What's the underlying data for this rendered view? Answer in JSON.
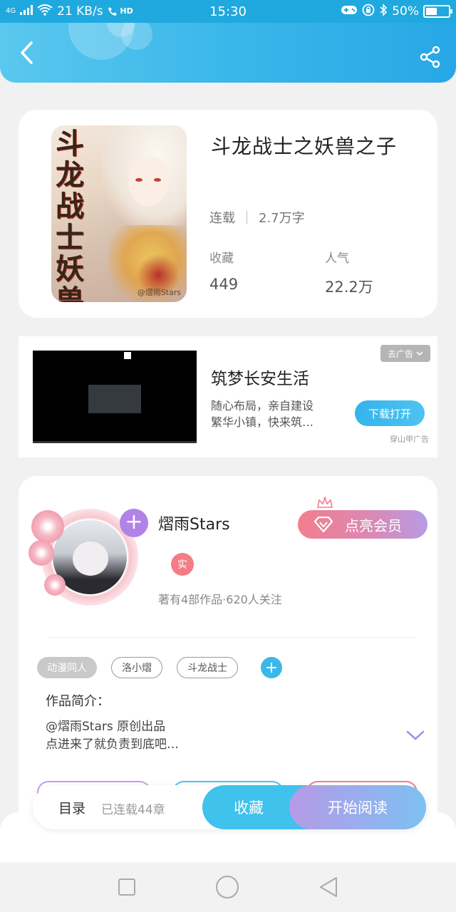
{
  "status_bar": {
    "network": "4G",
    "speed": "21 KB/s",
    "hd": "HD",
    "time": "15:30",
    "battery_percent": "50%",
    "battery_level": 0.5
  },
  "header": {
    "back_icon": "back-arrow-icon",
    "share_icon": "share-icon"
  },
  "book": {
    "title": "斗龙战士之妖兽之子",
    "cover_title": "斗龙战士妖兽之子",
    "cover_watermark": "@熠雨Stars",
    "status": "连载",
    "word_count": "2.7万字",
    "favorites_label": "收藏",
    "favorites_value": "449",
    "popularity_label": "人气",
    "popularity_value": "22.2万"
  },
  "ad": {
    "close_label": "去广告",
    "title": "筑梦长安生活",
    "desc_line1": "随心布局，亲自建设",
    "desc_line2": "繁华小镇，快来筑…",
    "button_label": "下载打开",
    "source": "穿山甲广告"
  },
  "author": {
    "name": "熠雨Stars",
    "verified_label": "实",
    "stats": "著有4部作品·620人关注",
    "vip_button": "点亮会员",
    "tags": [
      "动漫同人",
      "洛小熠",
      "斗龙战士"
    ],
    "intro_label": "作品简介：",
    "intro_line1": "@熠雨Stars 原创出品",
    "intro_line2": "点进来了就负责到底吧…"
  },
  "action_bar": {
    "toc_label": "目录",
    "chapters": "已连载44章",
    "favorite_button": "收藏",
    "read_button": "开始阅读"
  },
  "colors": {
    "header": "#3db8ea",
    "accent_blue": "#3fc2ec",
    "vip_pink": "#f27e8e",
    "purple": "#b183e7"
  }
}
